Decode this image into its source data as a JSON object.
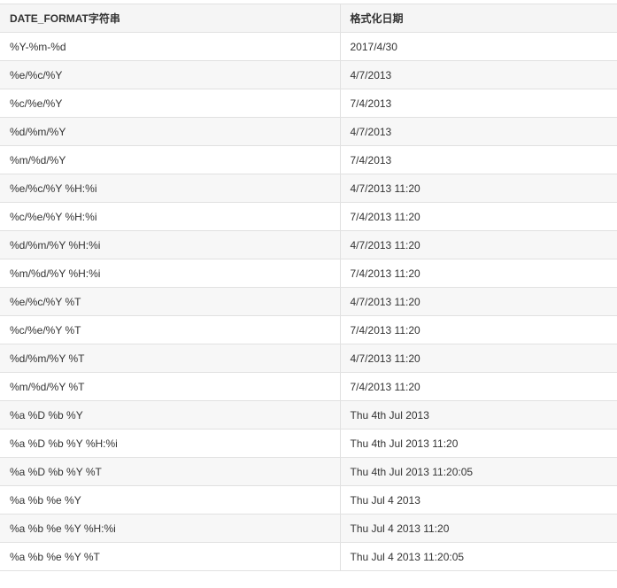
{
  "table": {
    "headers": [
      "DATE_FORMAT字符串",
      "格式化日期"
    ],
    "rows": [
      [
        "%Y-%m-%d",
        "2017/4/30"
      ],
      [
        "%e/%c/%Y",
        "4/7/2013"
      ],
      [
        "%c/%e/%Y",
        "7/4/2013"
      ],
      [
        "%d/%m/%Y",
        "4/7/2013"
      ],
      [
        "%m/%d/%Y",
        "7/4/2013"
      ],
      [
        "%e/%c/%Y %H:%i",
        "4/7/2013 11:20"
      ],
      [
        "%c/%e/%Y %H:%i",
        "7/4/2013 11:20"
      ],
      [
        "%d/%m/%Y %H:%i",
        "4/7/2013 11:20"
      ],
      [
        "%m/%d/%Y %H:%i",
        "7/4/2013 11:20"
      ],
      [
        "%e/%c/%Y %T",
        "4/7/2013 11:20"
      ],
      [
        "%c/%e/%Y %T",
        "7/4/2013 11:20"
      ],
      [
        "%d/%m/%Y %T",
        "4/7/2013 11:20"
      ],
      [
        "%m/%d/%Y %T",
        "7/4/2013 11:20"
      ],
      [
        "%a %D %b %Y",
        "Thu 4th Jul 2013"
      ],
      [
        "%a %D %b %Y %H:%i",
        "Thu 4th Jul 2013 11:20"
      ],
      [
        "%a %D %b %Y %T",
        "Thu 4th Jul 2013 11:20:05"
      ],
      [
        "%a %b %e %Y",
        "Thu Jul 4 2013"
      ],
      [
        "%a %b %e %Y %H:%i",
        "Thu Jul 4 2013 11:20"
      ],
      [
        "%a %b %e %Y %T",
        "Thu Jul 4 2013 11:20:05"
      ]
    ]
  }
}
